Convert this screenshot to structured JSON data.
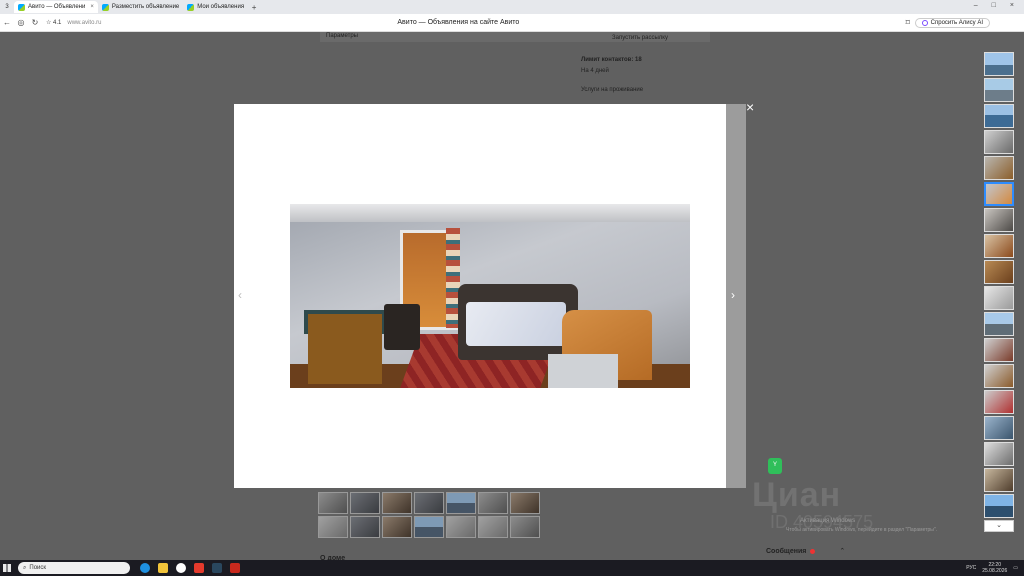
{
  "browser": {
    "tab_count": "3",
    "tabs": [
      {
        "label": "Авито — Объявлени"
      },
      {
        "label": "Разместить объявление"
      },
      {
        "label": "Мои объявления"
      }
    ],
    "rating": "4.1",
    "url": "www.avito.ru",
    "page_title": "Авито — Объявления на сайте Авито",
    "alice_label": "Спросить Алису AI"
  },
  "page_bg": {
    "params_tab": "Параметры",
    "subscribe_button": "Запустить рассылку",
    "contacts_limit": "Лимит контактов: 18",
    "days_label": "На 4 дней",
    "promo_text": "Услуги на проживание",
    "section_title": "О доме"
  },
  "viewer": {
    "photo_alt": "Комната с диваном",
    "prev_icon": "‹",
    "next_icon": "›",
    "close_icon": "×",
    "scroll_down_icon": "⌄"
  },
  "overlay": {
    "cian_logo": "Циан",
    "cian_id": "ID 40594575",
    "win_activation_1": "Активация Windows",
    "win_activation_2": "Чтобы активировать Windows, перейдите в раздел \"Параметры\".",
    "messages_label": "Сообщения",
    "badge_text": "Y"
  },
  "taskbar": {
    "search_placeholder": "Поиск",
    "lang": "РУС",
    "time": "22:20",
    "date": "25.08.2026"
  }
}
